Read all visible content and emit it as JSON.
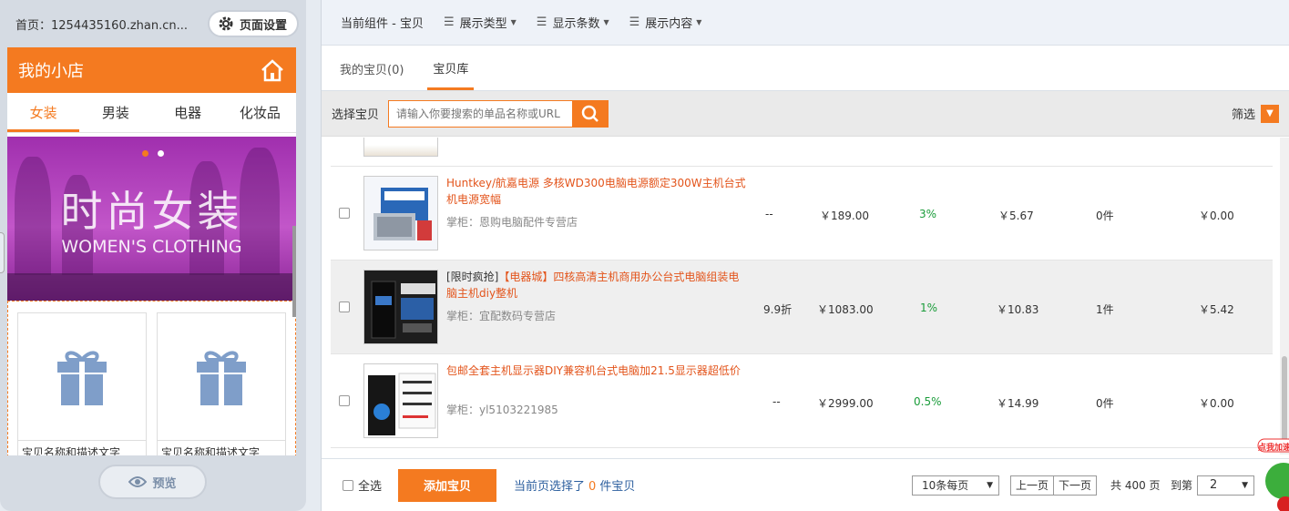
{
  "left": {
    "home_url": "首页：1254435160.zhan.cn...",
    "page_settings": "页面设置",
    "shop_name": "我的小店",
    "categories": [
      "女装",
      "男装",
      "电器",
      "化妆品"
    ],
    "banner_title": "时尚女装",
    "banner_sub": "WOMEN'S CLOTHING",
    "card_caption": "宝贝名称和描述文字",
    "preview": "预览"
  },
  "right": {
    "current_component": "当前组件 - 宝贝",
    "menus": [
      "展示类型",
      "显示条数",
      "展示内容"
    ],
    "tabs": [
      "我的宝贝(0)",
      "宝贝库"
    ],
    "select_label": "选择宝贝",
    "search_placeholder": "请输入你要搜索的单品名称或URL",
    "filter": "筛选"
  },
  "products": [
    {
      "title": "Huntkey/航嘉电源 多核WD300电脑电源额定300W主机台式机电源宽幅",
      "title_prefix": "",
      "seller": "掌柜：恩购电脑配件专营店",
      "discount": "--",
      "price": "￥189.00",
      "rate": "3%",
      "commission": "￥5.67",
      "sold": "0件",
      "earned": "￥0.00"
    },
    {
      "title_prefix": "[限时疯抢]",
      "title": "【电器城】四核高清主机商用办公台式电脑组装电脑主机diy整机",
      "seller": "掌柜：宜配数码专营店",
      "discount": "9.9折",
      "price": "￥1083.00",
      "rate": "1%",
      "commission": "￥10.83",
      "sold": "1件",
      "earned": "￥5.42"
    },
    {
      "title_prefix": "",
      "title": "包邮全套主机显示器DIY兼容机台式电脑加21.5显示器超低价",
      "seller": "掌柜：yl5103221985",
      "discount": "--",
      "price": "￥2999.00",
      "rate": "0.5%",
      "commission": "￥14.99",
      "sold": "0件",
      "earned": "￥0.00"
    }
  ],
  "bottom": {
    "select_all": "全选",
    "add_button": "添加宝贝",
    "selected_prefix": "当前页选择了",
    "selected_count": "0",
    "selected_suffix": "件宝贝",
    "per_page": "10条每页",
    "prev": "上一页",
    "next": "下一页",
    "total": "共 400 页",
    "goto": "到第",
    "page": "2"
  },
  "promo_text": "点我加速"
}
